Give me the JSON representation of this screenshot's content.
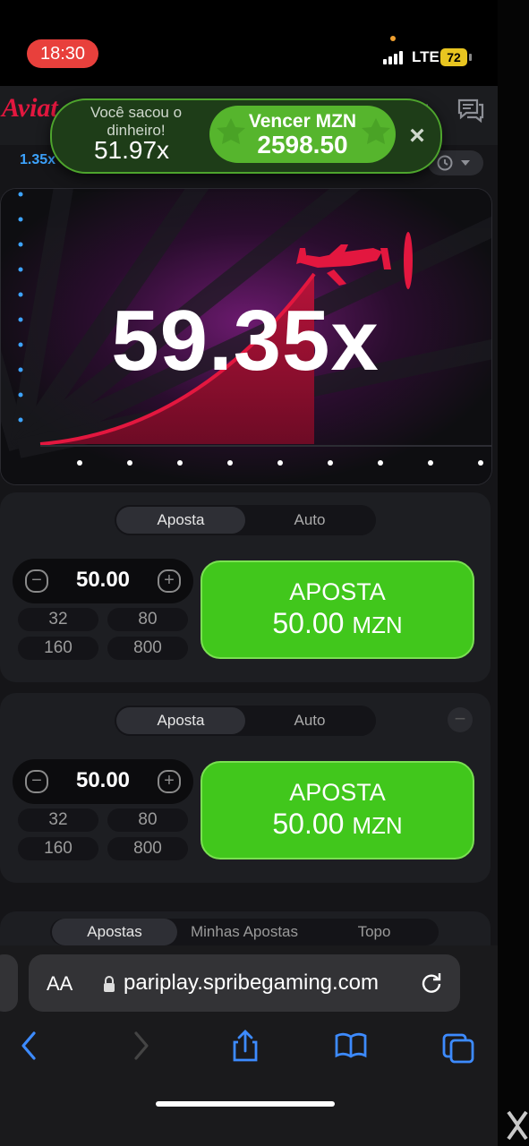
{
  "status": {
    "time": "18:30",
    "network": "LTE",
    "battery": "72"
  },
  "header": {
    "logo": "Aviat",
    "menu_icon": "menu-icon",
    "chat_icon": "chat-icon"
  },
  "history": {
    "last_multiplier": "1.35x",
    "history_icon": "clock-icon",
    "dropdown_icon": "chevron-down-icon"
  },
  "toast": {
    "label": "Você sacou o dinheiro!",
    "multiplier": "51.97x",
    "win_label": "Vencer MZN",
    "win_amount": "2598.50",
    "close": "×"
  },
  "game": {
    "multiplier": "59.35x",
    "accent": "#e3173f"
  },
  "bet_panels": [
    {
      "tab_bet": "Aposta",
      "tab_auto": "Auto",
      "amount": "50.00",
      "quick": [
        "32",
        "80",
        "160",
        "800"
      ],
      "button_title": "APOSTA",
      "button_amount": "50.00",
      "currency": "MZN"
    },
    {
      "tab_bet": "Aposta",
      "tab_auto": "Auto",
      "amount": "50.00",
      "quick": [
        "32",
        "80",
        "160",
        "800"
      ],
      "button_title": "APOSTA",
      "button_amount": "50.00",
      "currency": "MZN"
    }
  ],
  "bottom_tabs": [
    "Apostas",
    "Minhas Apostas",
    "Topo"
  ],
  "browser": {
    "aa": "AA",
    "url": "pariplay.spribegaming.com"
  },
  "colors": {
    "bet_green": "#41c71c",
    "toast_green": "#56b52d",
    "brand_red": "#e3173f",
    "history_blue": "#3da4ff"
  }
}
